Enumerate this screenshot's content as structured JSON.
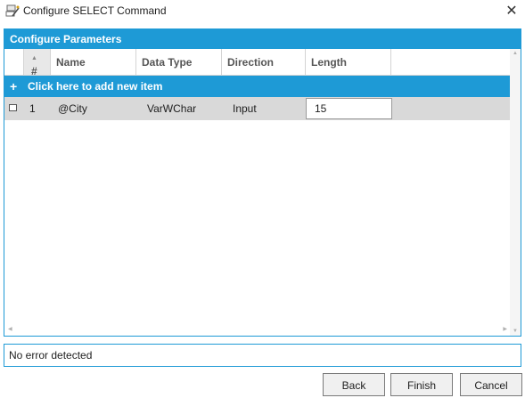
{
  "window": {
    "title": "Configure SELECT Command",
    "close_glyph": "✕"
  },
  "panel": {
    "header": "Configure Parameters"
  },
  "grid": {
    "columns": {
      "number": "#",
      "name": "Name",
      "data_type": "Data Type",
      "direction": "Direction",
      "length": "Length"
    },
    "add_row_label": "Click here to add new item",
    "rows": [
      {
        "number": "1",
        "name": "@City",
        "data_type": "VarWChar",
        "direction": "Input",
        "length": "15"
      }
    ]
  },
  "status": {
    "text": "No error detected"
  },
  "buttons": {
    "back": "Back",
    "finish": "Finish",
    "cancel": "Cancel"
  },
  "colors": {
    "accent": "#1e9ad6",
    "row_selected": "#d9d9d9"
  }
}
